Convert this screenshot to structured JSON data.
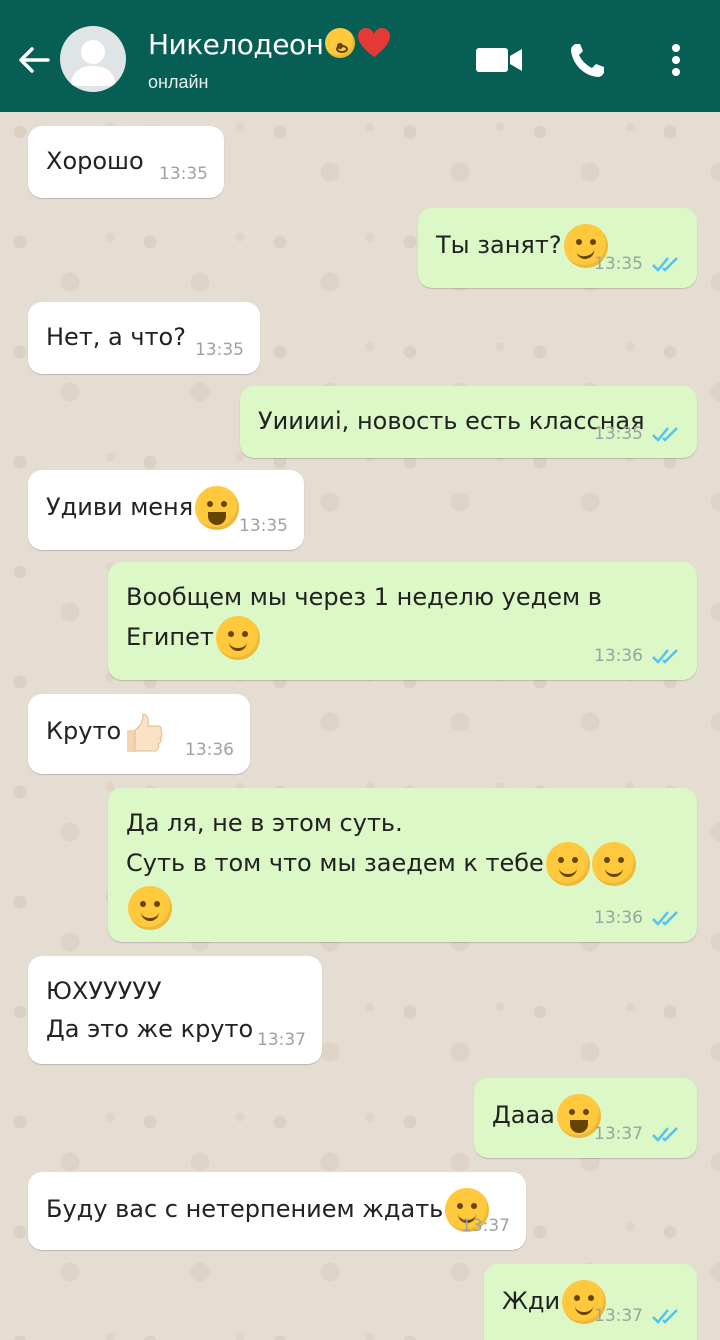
{
  "header": {
    "contact_name": "Никелодеон",
    "status": "онлайн",
    "name_emojis": [
      "kissing-face-icon",
      "red-heart-icon"
    ],
    "actions": [
      "video-call-icon",
      "phone-icon",
      "more-vert-icon"
    ]
  },
  "colors": {
    "header_bg": "#075e54",
    "outgoing_bubble": "#dcf8c6",
    "incoming_bubble": "#ffffff",
    "read_ticks": "#4fc3f7"
  },
  "messages": [
    {
      "dir": "in",
      "text": "Хорошо",
      "time": "13:35"
    },
    {
      "dir": "out",
      "text": "Ты занят?",
      "emoji": "thinking-face-icon",
      "time": "13:35",
      "status": "read"
    },
    {
      "dir": "in",
      "text": "Нет, а что?",
      "time": "13:35"
    },
    {
      "dir": "out",
      "text": "Уииииi, новость есть классная",
      "time": "13:35",
      "status": "read"
    },
    {
      "dir": "in",
      "text": "Удиви меня",
      "emoji": "tears-of-joy-icon",
      "time": "13:35"
    },
    {
      "dir": "out",
      "text": "Вообщем мы через 1 неделю уедем в Египет",
      "emoji": "smiling-face-icon",
      "time": "13:36",
      "status": "read"
    },
    {
      "dir": "in",
      "text": "Круто",
      "emoji": "thumbs-up-icon",
      "time": "13:36"
    },
    {
      "dir": "out",
      "text": "Да ля, не в этом суть.\nСуть в том что мы заедем к тебе",
      "emoji": "relieved-face-icon x3",
      "time": "13:36",
      "status": "read"
    },
    {
      "dir": "in",
      "text": "ЮХУУУУУ\nДа это же круто",
      "time": "13:37"
    },
    {
      "dir": "out",
      "text": "Дааа",
      "emoji": "grinning-squinting-face-icon",
      "time": "13:37",
      "status": "read"
    },
    {
      "dir": "in",
      "text": "Буду вас с нетерпением ждать",
      "emoji": "hugging-face-icon",
      "time": "13:37"
    },
    {
      "dir": "out",
      "text": "Жди",
      "emoji": "hugging-face-icon",
      "time": "13:37",
      "status": "read"
    }
  ]
}
